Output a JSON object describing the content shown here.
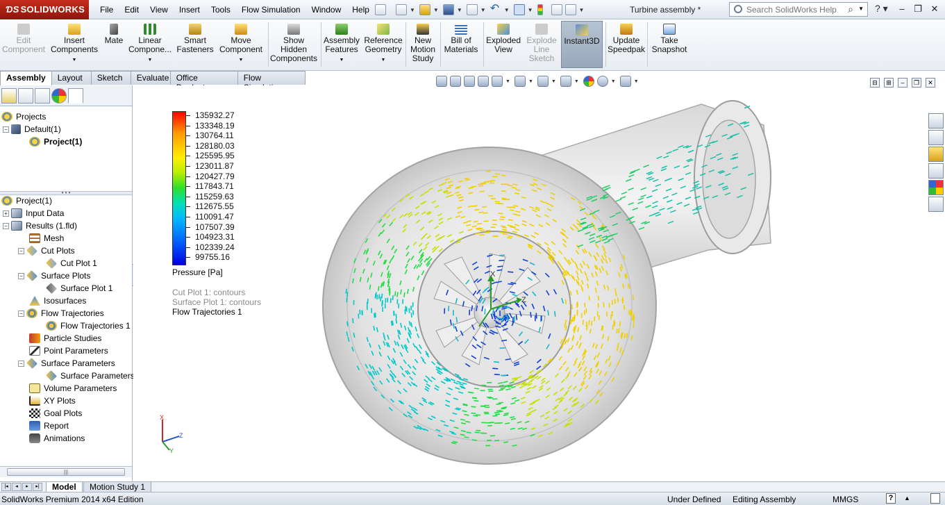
{
  "app": {
    "brand": "SOLIDWORKS",
    "document_title": "Turbine assembly *",
    "menus": [
      "File",
      "Edit",
      "View",
      "Insert",
      "Tools",
      "Flow Simulation",
      "Window",
      "Help"
    ],
    "search_placeholder": "Search SolidWorks Help"
  },
  "command_manager": [
    {
      "label": "Edit\nComponent",
      "icon": "edit-component-icon",
      "state": "disabled"
    },
    {
      "label": "Insert\nComponents",
      "icon": "insert-components-icon"
    },
    {
      "label": "Mate",
      "icon": "mate-icon"
    },
    {
      "label": "Linear\nCompone...",
      "icon": "linear-pattern-icon"
    },
    {
      "label": "Smart\nFasteners",
      "icon": "smart-fasteners-icon"
    },
    {
      "label": "Move\nComponent",
      "icon": "move-component-icon"
    },
    {
      "label": "Show\nHidden\nComponents",
      "icon": "show-hidden-icon"
    },
    {
      "label": "Assembly\nFeatures",
      "icon": "assembly-features-icon"
    },
    {
      "label": "Reference\nGeometry",
      "icon": "reference-geometry-icon"
    },
    {
      "label": "New\nMotion\nStudy",
      "icon": "motion-study-icon"
    },
    {
      "label": "Bill of\nMaterials",
      "icon": "bom-icon"
    },
    {
      "label": "Exploded\nView",
      "icon": "exploded-view-icon"
    },
    {
      "label": "Explode\nLine\nSketch",
      "icon": "explode-line-icon",
      "state": "disabled"
    },
    {
      "label": "Instant3D",
      "icon": "instant3d-icon",
      "state": "pressed"
    },
    {
      "label": "Update\nSpeedpak",
      "icon": "speedpak-icon"
    },
    {
      "label": "Take\nSnapshot",
      "icon": "snapshot-icon"
    }
  ],
  "command_tabs": [
    "Assembly",
    "Layout",
    "Sketch",
    "Evaluate",
    "Office Products",
    "Flow Simulation"
  ],
  "projects_tree": {
    "root": "Projects",
    "config": "Default(1)",
    "project": "Project(1)"
  },
  "analysis_tree": [
    "Project(1)",
    "Input Data",
    "Results (1.fld)",
    "Mesh",
    "Cut Plots",
    "Cut Plot 1",
    "Surface Plots",
    "Surface Plot 1",
    "Isosurfaces",
    "Flow Trajectories",
    "Flow Trajectories 1",
    "Particle Studies",
    "Point Parameters",
    "Surface Parameters",
    "Surface Parameters",
    "Volume Parameters",
    "XY Plots",
    "Goal Plots",
    "Report",
    "Animations"
  ],
  "legend": {
    "values": [
      "135932.27",
      "133348.19",
      "130764.11",
      "128180.03",
      "125595.95",
      "123011.87",
      "120427.79",
      "117843.71",
      "115259.63",
      "112675.55",
      "110091.47",
      "107507.39",
      "104923.31",
      "102339.24",
      "99755.16"
    ],
    "title": "Pressure [Pa]",
    "plots": [
      "Cut Plot 1: contours",
      "Surface Plot 1: contours",
      "Flow Trajectories 1"
    ]
  },
  "triad_labels": {
    "x": "X",
    "y": "Y",
    "z": "Z"
  },
  "bottom_tabs": [
    "Model",
    "Motion Study 1"
  ],
  "status": {
    "edition": "SolidWorks Premium 2014 x64 Edition",
    "definition": "Under Defined",
    "mode": "Editing Assembly",
    "units": "MMGS",
    "help": "?"
  },
  "colors": {
    "brand": "#b8220f",
    "accent": "#3a6fb0"
  }
}
